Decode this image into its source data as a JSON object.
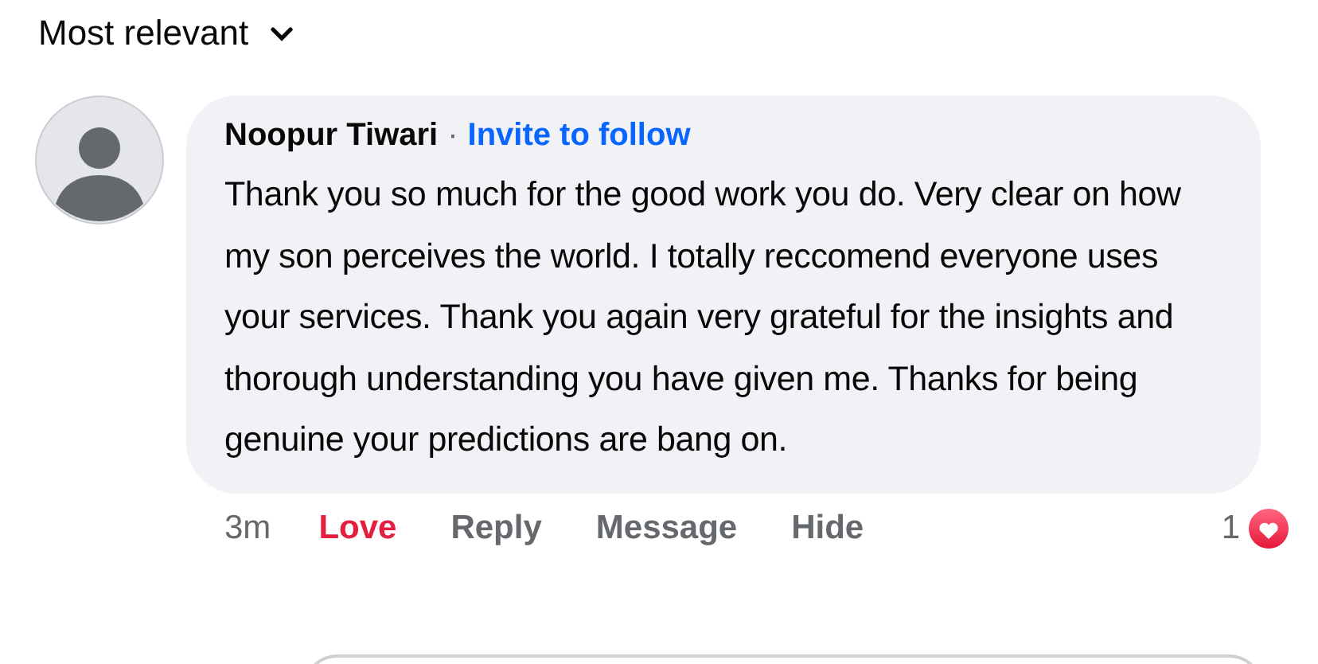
{
  "sort": {
    "label": "Most relevant"
  },
  "comment": {
    "author": "Noopur Tiwari",
    "separator": "·",
    "follow_link": "Invite to follow",
    "text": "Thank you so much for the good work you do. Very clear on how my son perceives the world. I totally reccomend everyone uses your services. Thank you again very grateful for the insights and thorough understanding you have given me. Thanks for being genuine your predictions are bang on.",
    "time": "3m",
    "actions": [
      {
        "label": "Love",
        "kind": "reaction",
        "selected": true
      },
      {
        "label": "Reply",
        "kind": "action",
        "selected": false
      },
      {
        "label": "Message",
        "kind": "action",
        "selected": false
      },
      {
        "label": "Hide",
        "kind": "action",
        "selected": false
      }
    ],
    "reaction_count": "1"
  }
}
